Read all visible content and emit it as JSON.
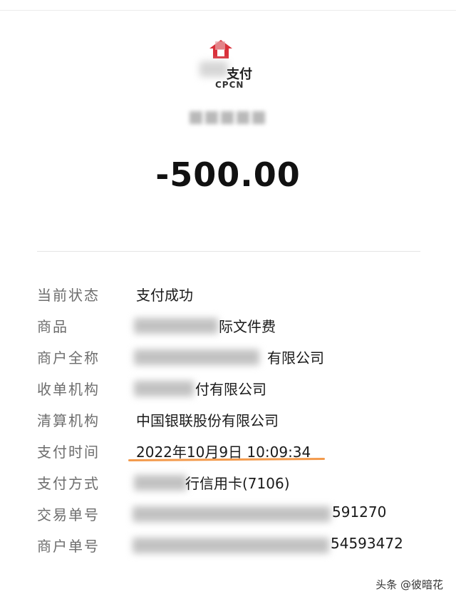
{
  "logo": {
    "name_suffix": "支付",
    "sub": "CPCN"
  },
  "amount": "-500.00",
  "details": {
    "status": {
      "label": "当前状态",
      "value": "支付成功"
    },
    "goods": {
      "label": "商品",
      "value": "际文件费"
    },
    "merchant": {
      "label": "商户全称",
      "value": "有限公司"
    },
    "acquirer": {
      "label": "收单机构",
      "value": "付有限公司"
    },
    "clearing": {
      "label": "清算机构",
      "value": "中国银联股份有限公司"
    },
    "time": {
      "label": "支付时间",
      "value": "2022年10月9日 10:09:34"
    },
    "method": {
      "label": "支付方式",
      "value": "行信用卡(7106)"
    },
    "trade_no": {
      "label": "交易单号",
      "value": "591270"
    },
    "order_no": {
      "label": "商户单号",
      "value": "54593472"
    }
  },
  "watermark": "头条 @彼暗花",
  "colors": {
    "highlight": "#f39a4c",
    "logo_red": "#d9303a"
  }
}
